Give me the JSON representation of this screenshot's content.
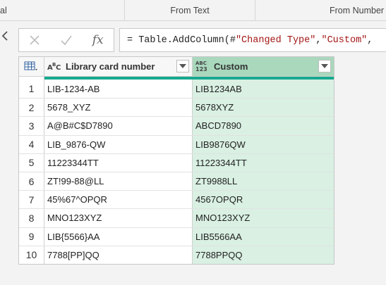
{
  "ribbon": {
    "left_fragment": "al",
    "group_from_text": "From Text",
    "group_from_number": "From Number"
  },
  "formula_bar": {
    "cancel_icon": "close-icon",
    "confirm_icon": "check-icon",
    "fx_label": "fx",
    "formula_prefix": "= Table.AddColumn(#",
    "formula_str1": "\"Changed Type\"",
    "formula_mid": ", ",
    "formula_str2": "\"Custom\"",
    "formula_suffix": ","
  },
  "table": {
    "columns": [
      {
        "type_icon": "ABC",
        "name": "Library card number"
      },
      {
        "type_icon": "ABC 123",
        "name": "Custom"
      }
    ],
    "rows": [
      {
        "n": "1",
        "library": "LIB-1234-AB",
        "custom": "LIB1234AB"
      },
      {
        "n": "2",
        "library": "5678_XYZ",
        "custom": "5678XYZ"
      },
      {
        "n": "3",
        "library": "A@B#C$D7890",
        "custom": "ABCD7890"
      },
      {
        "n": "4",
        "library": "LIB_9876-QW",
        "custom": "LIB9876QW"
      },
      {
        "n": "5",
        "library": "11223344TT",
        "custom": "11223344TT"
      },
      {
        "n": "6",
        "library": "ZT!99-88@LL",
        "custom": "ZT9988LL"
      },
      {
        "n": "7",
        "library": "45%67^OPQR",
        "custom": "4567OPQR"
      },
      {
        "n": "8",
        "library": "MNO123XYZ",
        "custom": "MNO123XYZ"
      },
      {
        "n": "9",
        "library": "LIB{5566}AA",
        "custom": "LIB5566AA"
      },
      {
        "n": "10",
        "library": "7788[PP]QQ",
        "custom": "7788PPQQ"
      }
    ]
  },
  "colors": {
    "accent": "#17a98f",
    "selected_header": "#a9d8bd",
    "selected_cells": "#d9f0e3"
  }
}
